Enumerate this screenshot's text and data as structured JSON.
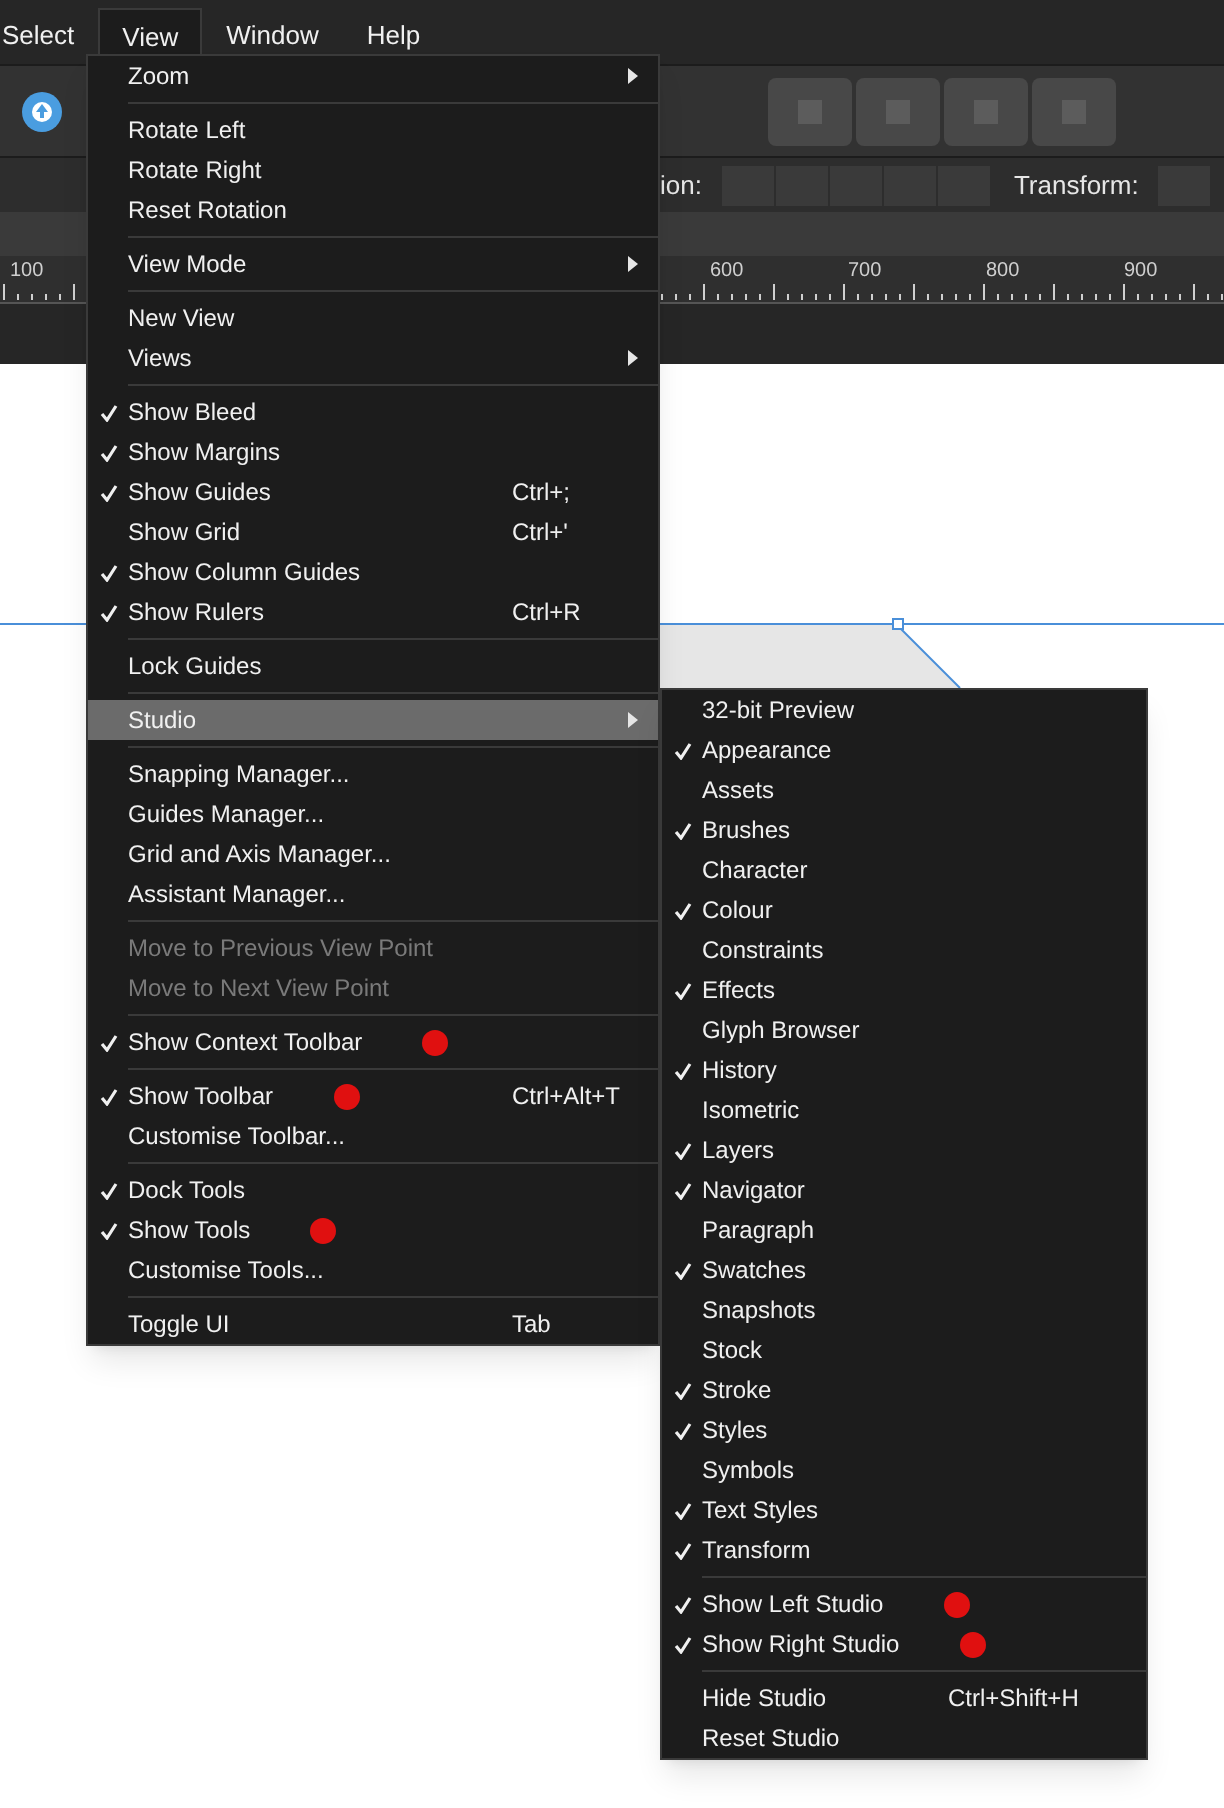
{
  "menubar": [
    {
      "label": "Select",
      "selected": false
    },
    {
      "label": "View",
      "selected": true
    },
    {
      "label": "Window",
      "selected": false
    },
    {
      "label": "Help",
      "selected": false
    }
  ],
  "context_toolbar": {
    "label_1": "ion:",
    "label_2": "Transform:"
  },
  "ruler": {
    "labels": [
      "100",
      "600",
      "700",
      "800",
      "900"
    ]
  },
  "view_menu": [
    [
      {
        "label": "Zoom",
        "checked": false,
        "disabled": false,
        "submenu": true,
        "selected": false,
        "marked": false
      }
    ],
    [
      {
        "label": "Rotate Left",
        "checked": false,
        "disabled": false,
        "submenu": false,
        "selected": false,
        "marked": false
      },
      {
        "label": "Rotate Right",
        "checked": false,
        "disabled": false,
        "submenu": false,
        "selected": false,
        "marked": false
      },
      {
        "label": "Reset Rotation",
        "checked": false,
        "disabled": false,
        "submenu": false,
        "selected": false,
        "marked": false
      }
    ],
    [
      {
        "label": "View Mode",
        "checked": false,
        "disabled": false,
        "submenu": true,
        "selected": false,
        "marked": false
      }
    ],
    [
      {
        "label": "New View",
        "checked": false,
        "disabled": false,
        "submenu": false,
        "selected": false,
        "marked": false
      },
      {
        "label": "Views",
        "checked": false,
        "disabled": false,
        "submenu": true,
        "selected": false,
        "marked": false
      }
    ],
    [
      {
        "label": "Show Bleed",
        "checked": true,
        "disabled": false,
        "submenu": false,
        "selected": false,
        "marked": false
      },
      {
        "label": "Show Margins",
        "checked": true,
        "disabled": false,
        "submenu": false,
        "selected": false,
        "marked": false
      },
      {
        "label": "Show Guides",
        "shortcut": "Ctrl+;",
        "checked": true,
        "disabled": false,
        "submenu": false,
        "selected": false,
        "marked": false
      },
      {
        "label": "Show Grid",
        "shortcut": "Ctrl+'",
        "checked": false,
        "disabled": false,
        "submenu": false,
        "selected": false,
        "marked": false
      },
      {
        "label": "Show Column Guides",
        "checked": true,
        "disabled": false,
        "submenu": false,
        "selected": false,
        "marked": false
      },
      {
        "label": "Show Rulers",
        "shortcut": "Ctrl+R",
        "checked": true,
        "disabled": false,
        "submenu": false,
        "selected": false,
        "marked": false
      }
    ],
    [
      {
        "label": "Lock Guides",
        "checked": false,
        "disabled": false,
        "submenu": false,
        "selected": false,
        "marked": false
      }
    ],
    [
      {
        "label": "Studio",
        "checked": false,
        "disabled": false,
        "submenu": true,
        "selected": true,
        "marked": false
      }
    ],
    [
      {
        "label": "Snapping Manager...",
        "checked": false,
        "disabled": false,
        "submenu": false,
        "selected": false,
        "marked": false
      },
      {
        "label": "Guides Manager...",
        "checked": false,
        "disabled": false,
        "submenu": false,
        "selected": false,
        "marked": false
      },
      {
        "label": "Grid and Axis Manager...",
        "checked": false,
        "disabled": false,
        "submenu": false,
        "selected": false,
        "marked": false
      },
      {
        "label": "Assistant Manager...",
        "checked": false,
        "disabled": false,
        "submenu": false,
        "selected": false,
        "marked": false
      }
    ],
    [
      {
        "label": "Move to Previous View Point",
        "checked": false,
        "disabled": true,
        "submenu": false,
        "selected": false,
        "marked": false
      },
      {
        "label": "Move to Next View Point",
        "checked": false,
        "disabled": true,
        "submenu": false,
        "selected": false,
        "marked": false
      }
    ],
    [
      {
        "label": "Show Context Toolbar",
        "checked": true,
        "disabled": false,
        "submenu": false,
        "selected": false,
        "marked": true
      }
    ],
    [
      {
        "label": "Show Toolbar",
        "shortcut": "Ctrl+Alt+T",
        "checked": true,
        "disabled": false,
        "submenu": false,
        "selected": false,
        "marked": true
      },
      {
        "label": "Customise Toolbar...",
        "checked": false,
        "disabled": false,
        "submenu": false,
        "selected": false,
        "marked": false
      }
    ],
    [
      {
        "label": "Dock Tools",
        "checked": true,
        "disabled": false,
        "submenu": false,
        "selected": false,
        "marked": false
      },
      {
        "label": "Show Tools",
        "checked": true,
        "disabled": false,
        "submenu": false,
        "selected": false,
        "marked": true
      },
      {
        "label": "Customise Tools...",
        "checked": false,
        "disabled": false,
        "submenu": false,
        "selected": false,
        "marked": false
      }
    ],
    [
      {
        "label": "Toggle UI",
        "shortcut": "Tab",
        "checked": false,
        "disabled": false,
        "submenu": false,
        "selected": false,
        "marked": false
      }
    ]
  ],
  "studio_menu": [
    [
      {
        "label": "32-bit Preview",
        "checked": false,
        "marked": false
      },
      {
        "label": "Appearance",
        "checked": true,
        "marked": false
      },
      {
        "label": "Assets",
        "checked": false,
        "marked": false
      },
      {
        "label": "Brushes",
        "checked": true,
        "marked": false
      },
      {
        "label": "Character",
        "checked": false,
        "marked": false
      },
      {
        "label": "Colour",
        "checked": true,
        "marked": false
      },
      {
        "label": "Constraints",
        "checked": false,
        "marked": false
      },
      {
        "label": "Effects",
        "checked": true,
        "marked": false
      },
      {
        "label": "Glyph Browser",
        "checked": false,
        "marked": false
      },
      {
        "label": "History",
        "checked": true,
        "marked": false
      },
      {
        "label": "Isometric",
        "checked": false,
        "marked": false
      },
      {
        "label": "Layers",
        "checked": true,
        "marked": false
      },
      {
        "label": "Navigator",
        "checked": true,
        "marked": false
      },
      {
        "label": "Paragraph",
        "checked": false,
        "marked": false
      },
      {
        "label": "Swatches",
        "checked": true,
        "marked": false
      },
      {
        "label": "Snapshots",
        "checked": false,
        "marked": false
      },
      {
        "label": "Stock",
        "checked": false,
        "marked": false
      },
      {
        "label": "Stroke",
        "checked": true,
        "marked": false
      },
      {
        "label": "Styles",
        "checked": true,
        "marked": false
      },
      {
        "label": "Symbols",
        "checked": false,
        "marked": false
      },
      {
        "label": "Text Styles",
        "checked": true,
        "marked": false
      },
      {
        "label": "Transform",
        "checked": true,
        "marked": false
      }
    ],
    [
      {
        "label": "Show Left Studio",
        "checked": true,
        "marked": true
      },
      {
        "label": "Show Right Studio",
        "checked": true,
        "marked": true
      }
    ],
    [
      {
        "label": "Hide Studio",
        "shortcut": "Ctrl+Shift+H",
        "checked": false,
        "marked": false
      },
      {
        "label": "Reset Studio",
        "checked": false,
        "marked": false
      }
    ]
  ]
}
